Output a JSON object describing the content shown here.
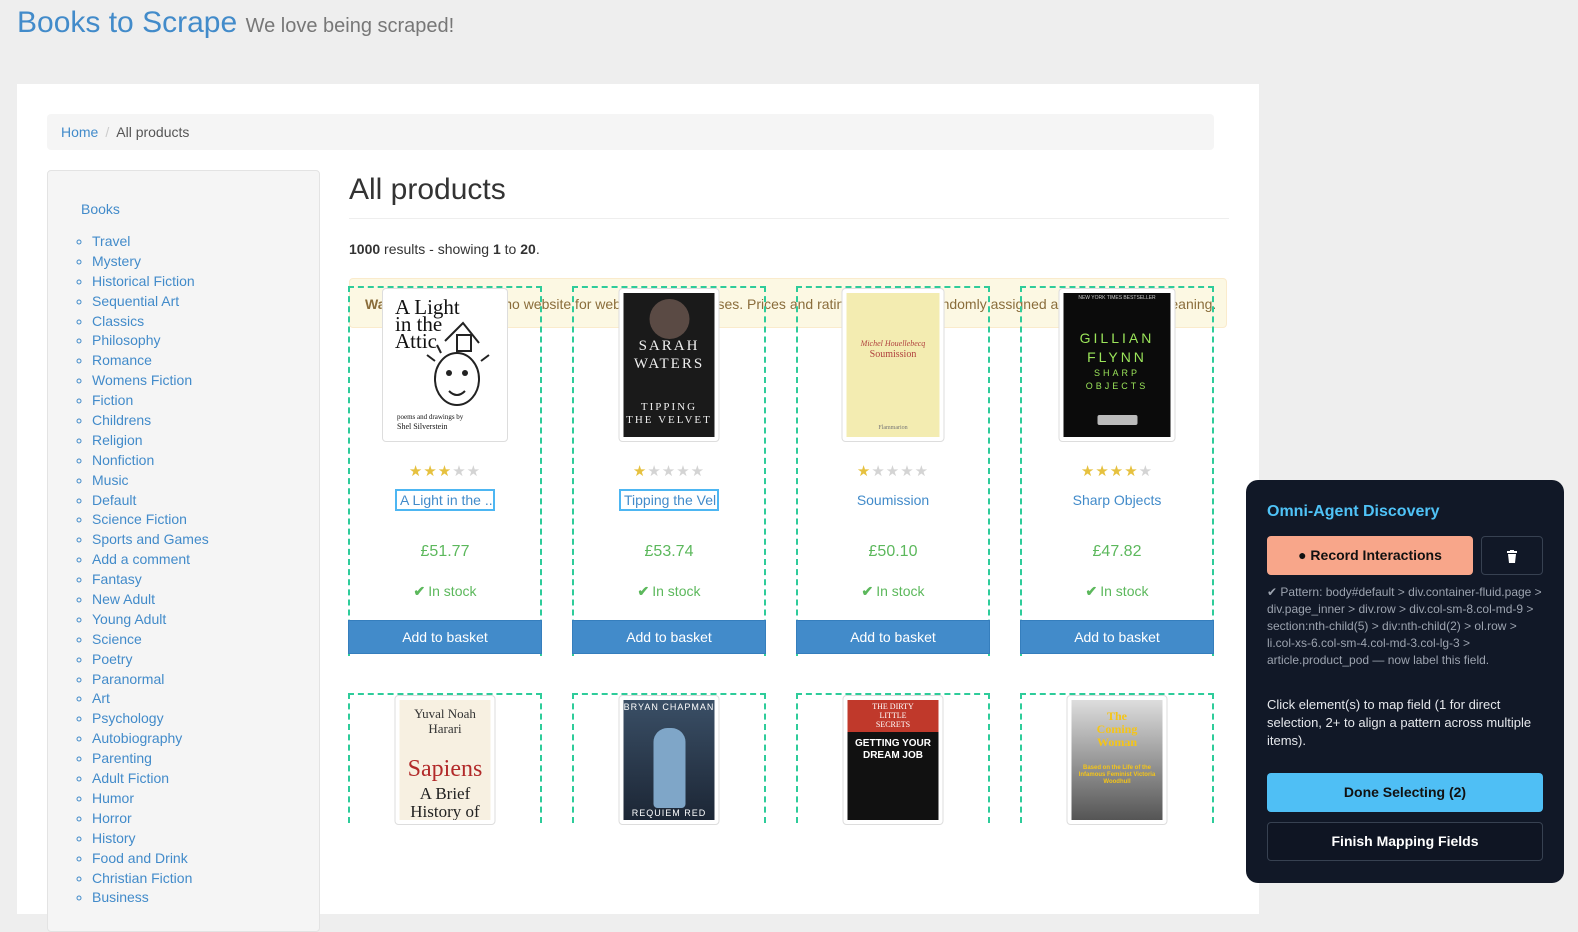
{
  "header": {
    "brand": "Books to Scrape",
    "tagline": "We love being scraped!"
  },
  "breadcrumb": {
    "home": "Home",
    "sep": "/",
    "current": "All products"
  },
  "sidebar": {
    "root": "Books",
    "categories": [
      "Travel",
      "Mystery",
      "Historical Fiction",
      "Sequential Art",
      "Classics",
      "Philosophy",
      "Romance",
      "Womens Fiction",
      "Fiction",
      "Childrens",
      "Religion",
      "Nonfiction",
      "Music",
      "Default",
      "Science Fiction",
      "Sports and Games",
      "Add a comment",
      "Fantasy",
      "New Adult",
      "Young Adult",
      "Science",
      "Poetry",
      "Paranormal",
      "Art",
      "Psychology",
      "Autobiography",
      "Parenting",
      "Adult Fiction",
      "Humor",
      "Horror",
      "History",
      "Food and Drink",
      "Christian Fiction",
      "Business"
    ]
  },
  "main": {
    "heading": "All products",
    "results": {
      "total": "1000",
      "text1": " results - showing ",
      "from": "1",
      "text2": " to ",
      "to": "20",
      "text3": "."
    },
    "warning": {
      "strong": "Warning!",
      "text": " This is a demo website for web scraping purposes. Prices and ratings here were randomly assigned and have no real meaning."
    }
  },
  "products": [
    {
      "title": "A Light in the ...",
      "rating": 3,
      "price": "£51.77",
      "availability": "In stock",
      "button": "Add to basket",
      "cover": {
        "l1": "A Light",
        "l2": "in the",
        "l3": "Attic",
        "l4": "poems and drawings by",
        "l5": "Shel Silverstein"
      }
    },
    {
      "title": "Tipping the Velvet",
      "rating": 1,
      "price": "£53.74",
      "availability": "In stock",
      "button": "Add to basket",
      "cover": {
        "l1": "SARAH",
        "l2": "WATERS",
        "l3": "TIPPING",
        "l4": "THE VELVET"
      }
    },
    {
      "title": "Soumission",
      "rating": 1,
      "price": "£50.10",
      "availability": "In stock",
      "button": "Add to basket",
      "cover": {
        "l1": "Michel Houellebecq",
        "l2": "Soumission",
        "l3": "Flammarion"
      }
    },
    {
      "title": "Sharp Objects",
      "rating": 4,
      "price": "£47.82",
      "availability": "In stock",
      "button": "Add to basket",
      "cover": {
        "l0": "NEW YORK TIMES BESTSELLER",
        "l1": "GILLIAN",
        "l2": "FLYNN",
        "l3": "SHARP",
        "l4": "OBJECTS"
      }
    },
    {
      "cover": {
        "l1": "Yuval Noah",
        "l2": "Harari",
        "l3": "Sapiens",
        "l4": "A Brief",
        "l5": "History of"
      }
    },
    {
      "cover": {
        "l1": "BRYAN CHAPMAN",
        "l2": "REQUIEM RED"
      }
    },
    {
      "cover": {
        "l1": "THE DIRTY",
        "l2": "LITTLE",
        "l3": "SECRETS",
        "l4": "GETTING YOUR",
        "l5": "DREAM JOB"
      }
    },
    {
      "cover": {
        "l1": "The",
        "l2": "Coming",
        "l3": "Woman",
        "l4": "Based on the Life of the Infamous Feminist Victoria Woodhull"
      }
    }
  ],
  "agent_panel": {
    "title": "Omni-Agent Discovery",
    "record_button": "● Record Interactions",
    "trash_icon": "trash-icon",
    "pattern": "✔ Pattern: body#default > div.container-fluid.page > div.page_inner > div.row > div.col-sm-8.col-md-9 > section:nth-child(5) > div:nth-child(2) > ol.row > li.col-xs-6.col-sm-4.col-md-3.col-lg-3 > article.product_pod — now label this field.",
    "instructions": "Click element(s) to map field (1 for direct selection, 2+ to align a pattern across multiple items).",
    "done_button": "Done Selecting (2)",
    "finish_button": "Finish Mapping Fields"
  },
  "colors": {
    "link": "#428bca",
    "price": "#5cb85c",
    "basket": "#428bca",
    "selection": "#2ecc9a",
    "panel_bg": "#111827",
    "panel_accent": "#4fc3f7",
    "record": "#f8a68a"
  }
}
